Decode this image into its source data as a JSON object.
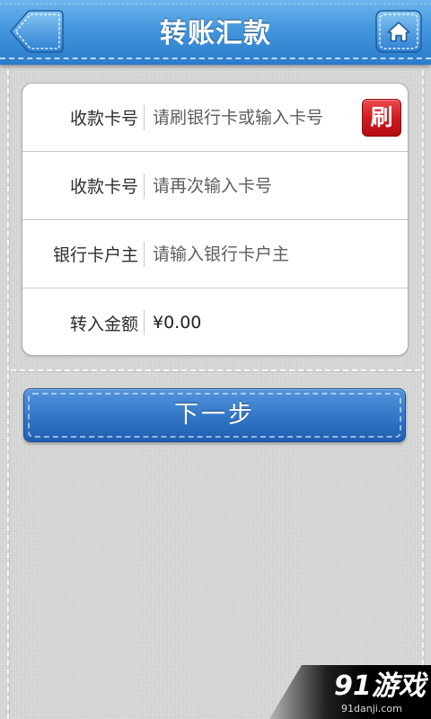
{
  "header": {
    "title": "转账汇款",
    "back_icon": "back-arrow-icon",
    "home_icon": "home-icon"
  },
  "form": {
    "rows": [
      {
        "label": "收款卡号",
        "placeholder": "请刷银行卡或输入卡号"
      },
      {
        "label": "收款卡号",
        "placeholder": "请再次输入卡号"
      },
      {
        "label": "银行卡户主",
        "placeholder": "请输入银行卡户主"
      },
      {
        "label": "转入金额",
        "value": "¥0.00"
      }
    ],
    "swipe_button_label": "刷"
  },
  "next_button": {
    "label": "下一步"
  },
  "watermark": {
    "logo": "91游戏",
    "site": "91danji.com"
  },
  "colors": {
    "header_blue": "#2f80cf",
    "swipe_button_red": "#cc1a1e",
    "next_button_blue": "#2b6ec2",
    "background_gray": "#d6d6d4"
  }
}
